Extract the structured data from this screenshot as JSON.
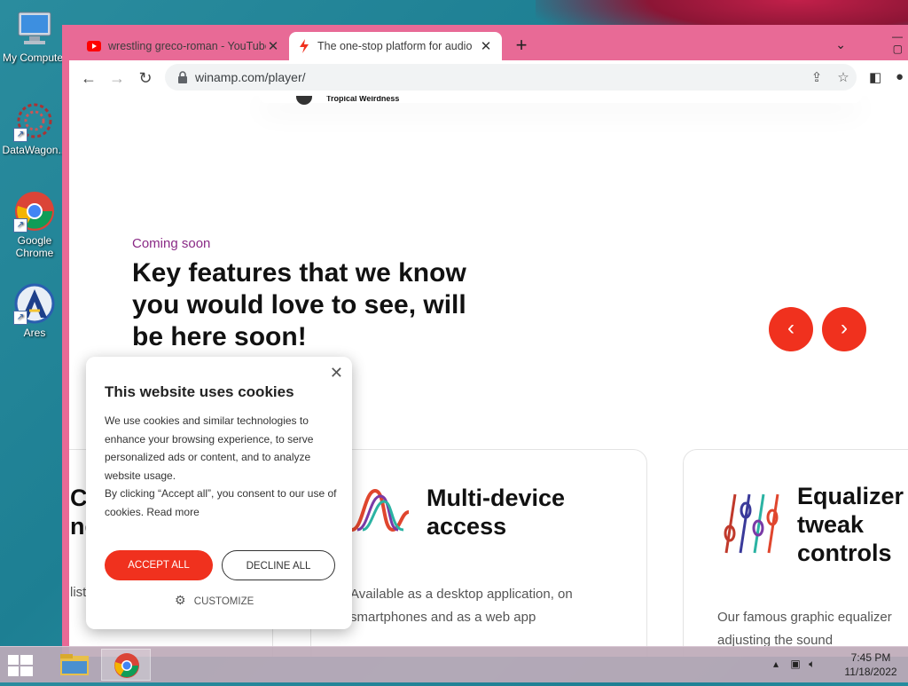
{
  "desktop": {
    "icons": [
      {
        "label": "My Computer",
        "name": "my-computer"
      },
      {
        "label": "DataWagon...",
        "name": "datawagon"
      },
      {
        "label": "Google Chrome",
        "name": "google-chrome"
      },
      {
        "label": "Ares",
        "name": "ares"
      }
    ]
  },
  "browser": {
    "tabs": [
      {
        "title": "wrestling greco-roman - YouTube",
        "icon": "youtube-icon",
        "active": false
      },
      {
        "title": "The one-stop platform for audio",
        "icon": "winamp-icon",
        "active": true
      }
    ],
    "new_tab_label": "+",
    "address": "winamp.com/player/"
  },
  "page": {
    "ghost_row_name": "Tropical Weirdness",
    "coming_soon": "Coming soon",
    "headline": "Key features that we know you would love to see, will be here soon!",
    "cards": [
      {
        "title": "Cu ne",
        "desc": "list"
      },
      {
        "title": "Multi-device access",
        "desc": "Available as a desktop application, on smartphones and as a web app"
      },
      {
        "title": "Equalizer tweak controls",
        "desc": "Our famous graphic equalizer adjusting the sound"
      }
    ]
  },
  "cookie_dialog": {
    "title": "This website uses cookies",
    "body_1": "We use cookies and similar technologies to enhance your browsing experience, to serve personalized ads or content, and to analyze website usage.",
    "body_2": "By clicking “Accept all”, you consent to our use of cookies.",
    "read_more": "Read more",
    "accept": "ACCEPT ALL",
    "decline": "DECLINE ALL",
    "customize": "CUSTOMIZE"
  },
  "taskbar": {
    "time": "7:45 PM",
    "date": "11/18/2022"
  },
  "colors": {
    "accent_red": "#f0311e",
    "coming_soon_purple": "#8a2a86",
    "window_frame_pink": "#e86a96"
  }
}
